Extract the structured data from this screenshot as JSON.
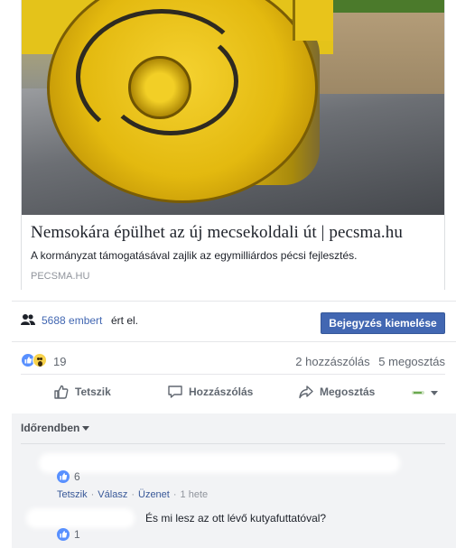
{
  "link_preview": {
    "title": "Nemsokára épülhet az új mecsekoldali út | pecsma.hu",
    "description": "A kormányzat támogatásával zajlik az egymilliárdos pécsi fejlesztés.",
    "domain": "PECSMA.HU"
  },
  "reach": {
    "icon": "people-icon",
    "count_text": "5688 embert",
    "suffix": "ért el.",
    "boost_button": "Bejegyzés kiemelése"
  },
  "stats": {
    "reactions_count": "19",
    "comments": "2 hozzászólás",
    "shares": "5 megosztás"
  },
  "actions": {
    "like": "Tetszik",
    "comment": "Hozzászólás",
    "share": "Megosztás"
  },
  "comments": {
    "sort_label": "Időrendben",
    "items": [
      {
        "likes": "6",
        "actions": {
          "like": "Tetszik",
          "reply": "Válasz",
          "message": "Üzenet",
          "time": "1 hete"
        }
      },
      {
        "text": "És mi lesz az ott lévő kutyafuttatóval?",
        "likes": "1"
      }
    ]
  },
  "colors": {
    "accent": "#4267b2",
    "link": "#385898",
    "muted": "#616770"
  }
}
